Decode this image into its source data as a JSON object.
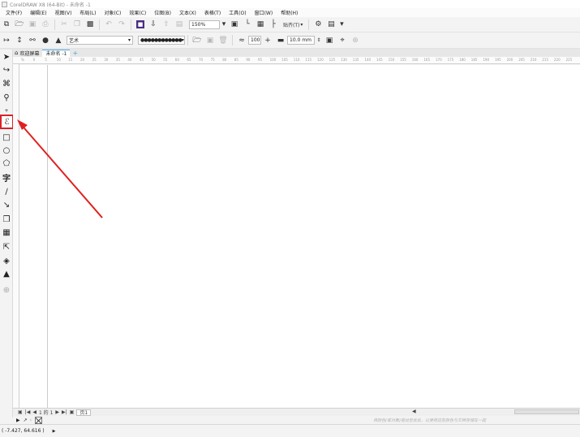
{
  "window": {
    "title": "CorelDRAW X8 (64-Bit) - 未命名 -1"
  },
  "menubar": {
    "items": [
      "文件(F)",
      "编辑(E)",
      "视图(V)",
      "布局(L)",
      "对象(C)",
      "效果(C)",
      "位图(B)",
      "文本(X)",
      "表格(T)",
      "工具(O)",
      "窗口(W)",
      "帮助(H)"
    ]
  },
  "toolbar1": {
    "zoom_value": "150%",
    "snap_label": "贴齐(T)"
  },
  "toolbar2": {
    "art_media_value": "艺术",
    "smoothing_value": "100",
    "width_value": "10.0 mm"
  },
  "doc_tabs": {
    "welcome": "欢迎屏幕",
    "document": "未命名 -1"
  },
  "pagebar": {
    "page_count": "1 的 1",
    "page_tab": "页1"
  },
  "colorbar": {
    "hint": "将颜色(或对象)拖动至此处，以便将这些颜色与文档存储在一起"
  },
  "statusbar": {
    "coordinates": "( -7.427, 64.616 )"
  },
  "ruler": {
    "top_labels": [
      "%",
      "0",
      "5",
      "10",
      "15",
      "20",
      "25",
      "30",
      "35",
      "40",
      "45",
      "50",
      "55",
      "60",
      "65",
      "70",
      "75",
      "80",
      "85",
      "90",
      "95",
      "100",
      "105",
      "110",
      "115",
      "120",
      "125",
      "130",
      "135",
      "140",
      "145",
      "150",
      "155",
      "160",
      "165",
      "170",
      "175",
      "180",
      "185",
      "190",
      "195",
      "200",
      "205",
      "210",
      "215",
      "220",
      "225"
    ]
  },
  "colors": {
    "highlight": "#d9232a",
    "arrow": "#e02020",
    "tab_accent": "#4aa3df",
    "color_swatch": "#4b2d85"
  }
}
